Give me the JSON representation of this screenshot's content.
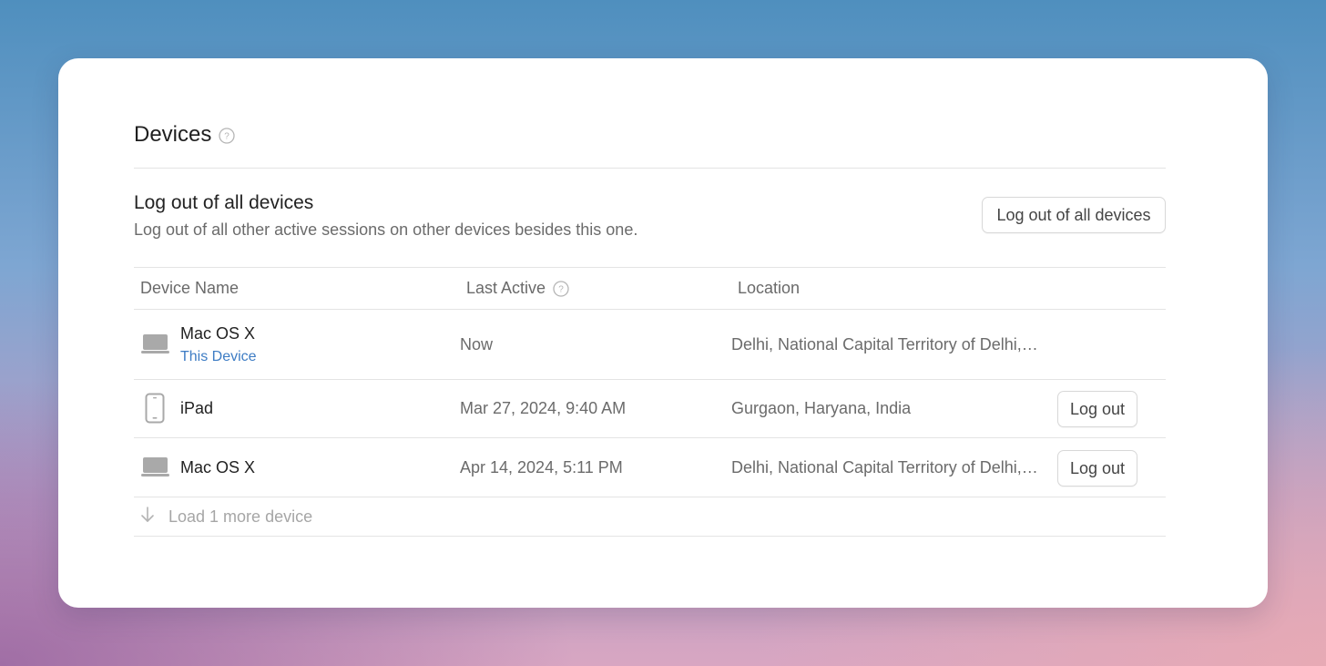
{
  "header": {
    "title": "Devices"
  },
  "logout_all": {
    "title": "Log out of all devices",
    "description": "Log out of all other active sessions on other devices besides this one.",
    "button_label": "Log out of all devices"
  },
  "table": {
    "columns": [
      "Device Name",
      "Last Active",
      "Location"
    ],
    "rows": [
      {
        "device": "Mac OS X",
        "subtitle": "This Device",
        "last_active": "Now",
        "location": "Delhi, National Capital Territory of Delhi,…",
        "icon": "laptop-icon"
      },
      {
        "device": "iPad",
        "last_active": "Mar 27, 2024, 9:40 AM",
        "location": "Gurgaon, Haryana, India",
        "action": "Log out",
        "icon": "tablet-icon"
      },
      {
        "device": "Mac OS X",
        "last_active": "Apr 14, 2024, 5:11 PM",
        "location": "Delhi, National Capital Territory of Delhi,…",
        "action": "Log out",
        "icon": "laptop-icon"
      }
    ],
    "load_more": "Load 1 more device"
  },
  "colors": {
    "accent": "#3d7cc4",
    "text": "#222222",
    "muted": "#6b6b6b"
  }
}
